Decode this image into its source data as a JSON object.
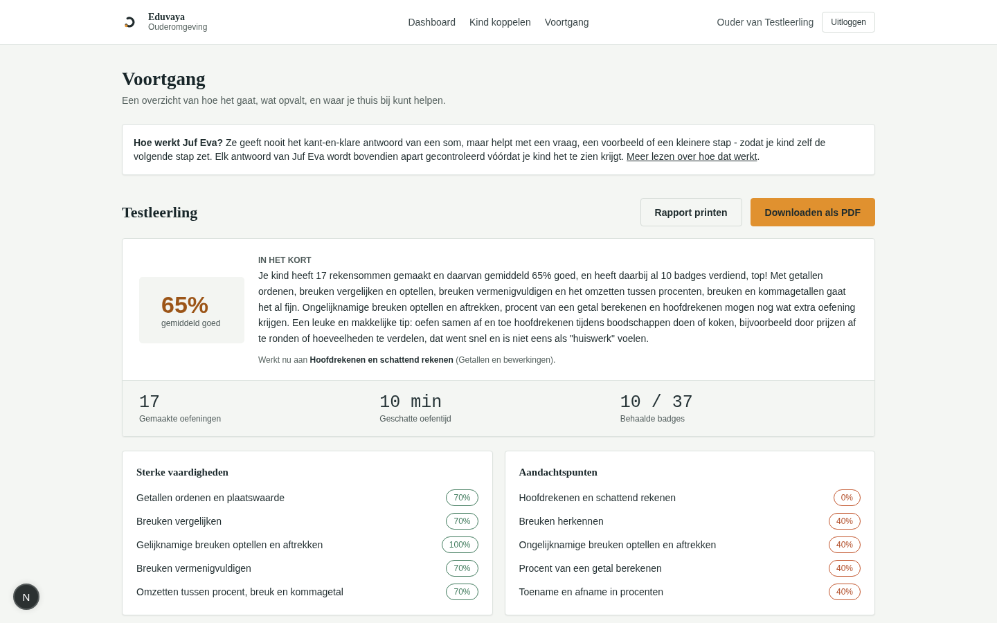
{
  "header": {
    "brand": "Eduvaya",
    "subtitle": "Ouderomgeving",
    "nav": [
      {
        "label": "Dashboard"
      },
      {
        "label": "Kind koppelen"
      },
      {
        "label": "Voortgang"
      }
    ],
    "user": "Ouder van Testleerling",
    "logout": "Uitloggen"
  },
  "page": {
    "title": "Voortgang",
    "subtitle": "Een overzicht van hoe het gaat, wat opvalt, en waar je thuis bij kunt helpen."
  },
  "info": {
    "text": "**Hoe werkt Juf Eva?** Ze geeft nooit het kant-en-klare antwoord van een som, maar helpt met een vraag, een voorbeeld of een kleinere stap - zodat je kind zelf de volgende stap zet. Elk antwoord van Juf Eva wordt bovendien apart gecontroleerd vóórdat je kind het te zien krijgt.",
    "link": "Meer lezen over hoe dat werkt",
    "after_link": "."
  },
  "student": {
    "name": "Testleerling",
    "actions": [
      {
        "label": "Rapport printen",
        "kind": "secondary"
      },
      {
        "label": "Downloaden als PDF",
        "kind": "primary"
      }
    ]
  },
  "summary": {
    "score": "65%",
    "score_label": "gemiddeld goed",
    "heading": "IN HET KORT",
    "text": "Je kind heeft 17 rekensommen gemaakt en daarvan gemiddeld 65% goed, en heeft daarbij al 10 badges verdiend, top! Met getallen ordenen, breuken vergelijken en optellen, breuken vermenigvuldigen en het omzetten tussen procenten, breuken en kommagetallen gaat het al fijn. Ongelijknamige breuken optellen en aftrekken, procent van een getal berekenen en hoofdrekenen mogen nog wat extra oefening krijgen. Een leuke en makkelijke tip: oefen samen af en toe hoofdrekenen tijdens boodschappen doen of koken, bijvoorbeeld door prijzen af te ronden of hoeveelheden te verdelen, dat went snel en is niet eens als \"huiswerk\" voelen.",
    "current": "Werkt nu aan **Hoofdrekenen en schattend rekenen** (Getallen en bewerkingen).",
    "stats": [
      {
        "value": "17",
        "label": "Gemaakte oefeningen"
      },
      {
        "value": "10 min",
        "label": "Geschatte oefentijd"
      },
      {
        "value": "10 / 37",
        "label": "Behaalde badges"
      }
    ]
  },
  "skill_panels": [
    {
      "title": "Sterke vaardigheden",
      "kind": "strong",
      "items": [
        {
          "name": "Getallen ordenen en plaatswaarde",
          "score": "70%"
        },
        {
          "name": "Breuken vergelijken",
          "score": "70%"
        },
        {
          "name": "Gelijknamige breuken optellen en aftrekken",
          "score": "100%"
        },
        {
          "name": "Breuken vermenigvuldigen",
          "score": "70%"
        },
        {
          "name": "Omzetten tussen procent, breuk en kommagetal",
          "score": "70%"
        }
      ]
    },
    {
      "title": "Aandachtspunten",
      "kind": "attention",
      "items": [
        {
          "name": "Hoofdrekenen en schattend rekenen",
          "score": "0%"
        },
        {
          "name": "Breuken herkennen",
          "score": "40%"
        },
        {
          "name": "Ongelijknamige breuken optellen en aftrekken",
          "score": "40%"
        },
        {
          "name": "Procent van een getal berekenen",
          "score": "40%"
        },
        {
          "name": "Toename en afname in procenten",
          "score": "40%"
        }
      ]
    }
  ],
  "dev_indicator": {
    "label": "N"
  }
}
